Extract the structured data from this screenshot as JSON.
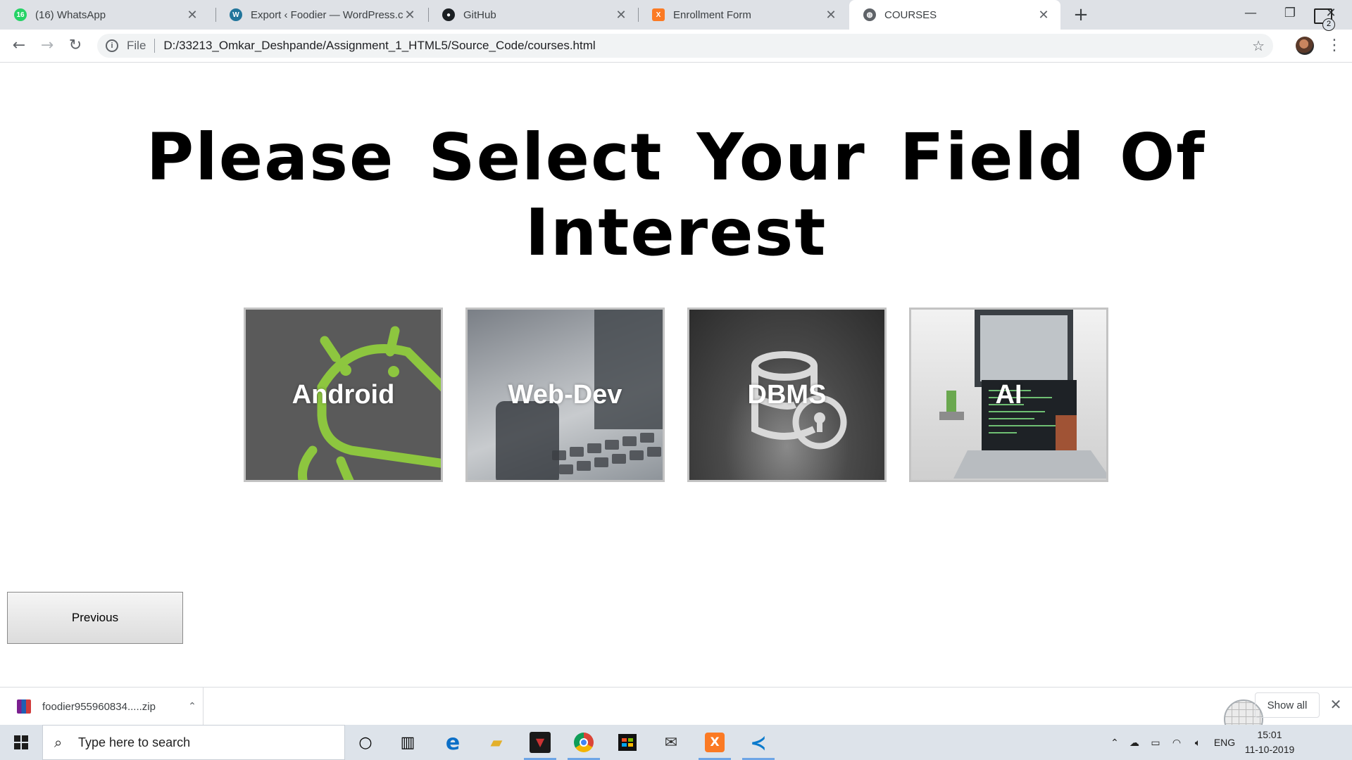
{
  "browser": {
    "tabs": [
      {
        "title": "(16) WhatsApp",
        "favicon": "whatsapp-icon",
        "favicon_badge": "16",
        "color": "#25d366"
      },
      {
        "title": "Export ‹ Foodier — WordPress.co",
        "favicon": "wordpress-icon",
        "color": "#21759b"
      },
      {
        "title": "GitHub",
        "favicon": "github-icon",
        "color": "#1b1f23"
      },
      {
        "title": "Enrollment Form",
        "favicon": "xampp-icon",
        "color": "#fb7a24"
      },
      {
        "title": "COURSES",
        "favicon": "globe-icon",
        "color": "#5f6368",
        "active": true
      }
    ],
    "address": {
      "scheme_label": "File",
      "url": "D:/33213_Omkar_Deshpande/Assignment_1_HTML5/Source_Code/courses.html"
    }
  },
  "page": {
    "heading": "Please Select Your Field Of Interest",
    "courses": [
      {
        "label": "Android",
        "image": "android-robot"
      },
      {
        "label": "Web-Dev",
        "image": "laptop-keyboard"
      },
      {
        "label": "DBMS",
        "image": "database-lock"
      },
      {
        "label": "AI",
        "image": "laptop-code"
      }
    ],
    "previous_button": "Previous"
  },
  "downloads": {
    "file_name": "foodier955960834.....zip",
    "show_all": "Show all"
  },
  "taskbar": {
    "search_placeholder": "Type here to search",
    "language": "ENG",
    "time": "15:01",
    "date": "11-10-2019",
    "notification_count": "2"
  }
}
